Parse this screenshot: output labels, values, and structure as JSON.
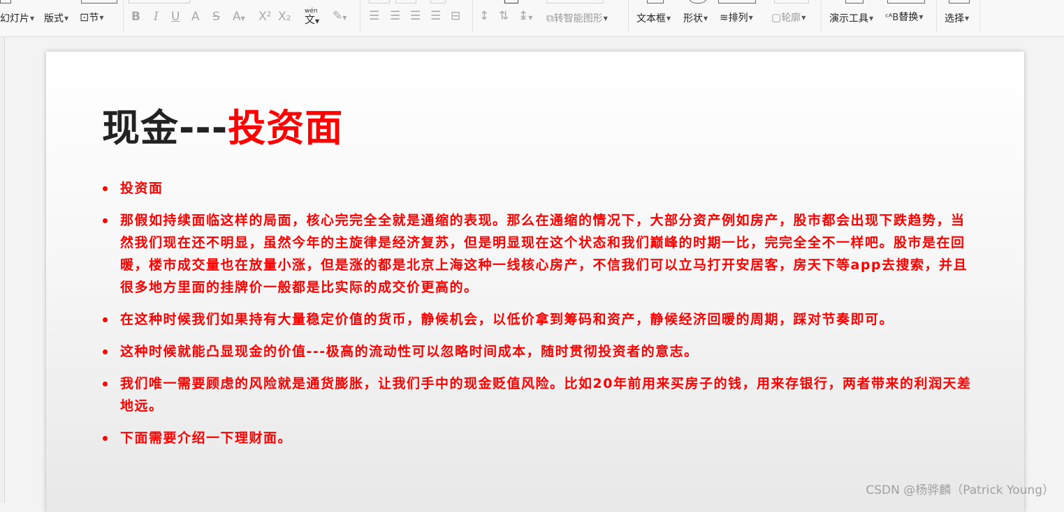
{
  "ribbon": {
    "slides_btn": "幻灯片",
    "layout_btn": "版式",
    "section_btn": "节",
    "bold_icon": "bold-icon",
    "italic_icon": "italic-icon",
    "wen_label": "wén",
    "smartart_label": "转智能图形",
    "textbox_btn": "文本框",
    "shape_btn": "形状",
    "arrange_btn": "排列",
    "outline_btn": "轮廓",
    "present_btn": "演示工具",
    "replace_btn": "替换",
    "select_btn": "选择"
  },
  "slide": {
    "title_black": "现金---",
    "title_red": "投资面",
    "bullets": [
      "投资面",
      "那假如持续面临这样的局面，核心完完全全就是通缩的表现。那么在通缩的情况下，大部分资产例如房产，股市都会出现下跌趋势，当然我们现在还不明显，虽然今年的主旋律是经济复苏，但是明显现在这个状态和我们巅峰的时期一比，完完全全不一样吧。股市是在回暖，楼市成交量也在放量小涨，但是涨的都是北京上海这种一线核心房产，不信我们可以立马打开安居客，房天下等app去搜索，并且很多地方里面的挂牌价一般都是比实际的成交价更高的。",
      "在这种时候我们如果持有大量稳定价值的货币，静候机会，以低价拿到筹码和资产，静候经济回暖的周期，踩对节奏即可。",
      "这种时候就能凸显现金的价值---极高的流动性可以忽略时间成本，随时贯彻投资者的意志。",
      "我们唯一需要顾虑的风险就是通货膨胀，让我们手中的现金贬值风险。比如20年前用来买房子的钱，用来存银行，两者带来的利润天差地远。",
      "下面需要介绍一下理财面。"
    ]
  },
  "watermark": "CSDN @杨骅麟（Patrick Young）",
  "colors": {
    "accent_red": "#ff0000",
    "title_dark": "#222222",
    "watermark": "#a0a0a0"
  }
}
